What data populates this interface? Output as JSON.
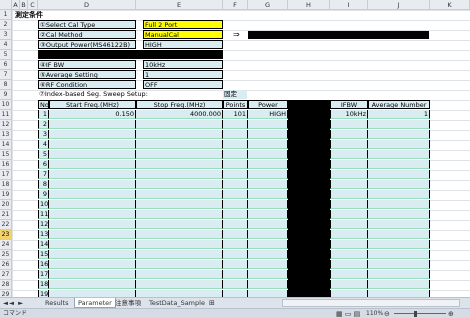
{
  "columns": [
    "A",
    "B",
    "C",
    "D",
    "E",
    "F",
    "G",
    "H",
    "I",
    "J",
    "K"
  ],
  "rows": [
    "1",
    "2",
    "3",
    "4",
    "5",
    "6",
    "7",
    "8",
    "9",
    "10",
    "11",
    "12",
    "13",
    "14",
    "15",
    "16",
    "17",
    "18",
    "19",
    "20",
    "21",
    "22",
    "23",
    "24",
    "25",
    "26",
    "27",
    "28",
    "29"
  ],
  "selected_row": "23",
  "title": "測定条件",
  "conditions": {
    "select_cal_type_label": "①Select Cal Type",
    "select_cal_type_value": "Full 2 Port",
    "cal_method_label": "②Cal Method",
    "cal_method_value": "ManualCal",
    "arrow": "⇒",
    "output_power_label": "③Output Power(MS46122B)",
    "output_power_value": "HIGH",
    "if_bw_label": "④IF BW",
    "if_bw_value": "10kHz",
    "average_label": "⑤Average Setting",
    "average_value": "1",
    "rf_label": "⑥RF Condition",
    "rf_value": "OFF",
    "sweep_label": "⑦Index-based Seg. Sweep Setup:",
    "fixed_label": "固定"
  },
  "table": {
    "headers": {
      "no": "No",
      "start": "Start Freq.(MHz)",
      "stop": "Stop Freq.(MHz)",
      "points": "Points",
      "power": "Power",
      "ifbw": "IFBW",
      "avg": "Average Number"
    },
    "first_row": {
      "start": "0.150",
      "stop": "4000.000",
      "points": "101",
      "power": "HIGH",
      "ifbw": "10kHz",
      "avg": "1"
    },
    "numbers": [
      "1",
      "2",
      "3",
      "4",
      "5",
      "6",
      "7",
      "8",
      "9",
      "10",
      "11",
      "12",
      "13",
      "14",
      "15",
      "16",
      "17",
      "18",
      "19"
    ]
  },
  "tabs": [
    "Results",
    "Parameter",
    "注意事項",
    "TestData_Sample"
  ],
  "active_tab": "Parameter",
  "status": {
    "mode": "コマンド",
    "zoom": "110%"
  }
}
